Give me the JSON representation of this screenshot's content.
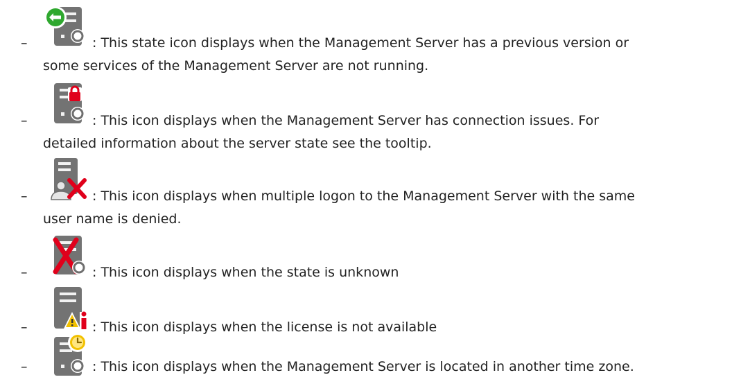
{
  "bullet": "–",
  "items": [
    {
      "icon": "server-previous-version-icon",
      "line1": ": This state icon displays when the Management Server has a previous version or",
      "line2": "some services of the Management Server are not running."
    },
    {
      "icon": "server-connection-issue-lock-icon",
      "line1": ": This icon displays when the Management Server has connection issues. For",
      "line2": "detailed information about the server state see the tooltip."
    },
    {
      "icon": "server-multiple-logon-denied-icon",
      "line1": ": This icon displays when multiple logon to the Management Server with the same",
      "line2": "user name is denied."
    },
    {
      "icon": "server-state-unknown-icon",
      "line1": ": This icon displays when the state is unknown"
    },
    {
      "icon": "server-license-unavailable-icon",
      "line1": ": This icon displays when the license is not available"
    },
    {
      "icon": "server-other-time-zone-icon",
      "line1": ": This icon displays when the Management Server is located in another time zone."
    }
  ],
  "colors": {
    "server_gray": "#6f6f6f",
    "server_light": "#e6e6e6",
    "green": "#2fa82f",
    "red": "#e0001b",
    "yellow": "#f2c100",
    "text": "#222222"
  }
}
